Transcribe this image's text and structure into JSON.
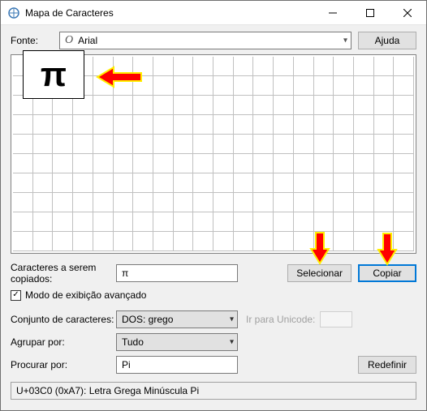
{
  "window": {
    "title": "Mapa de Caracteres"
  },
  "labels": {
    "fonte": "Fonte:",
    "ajuda": "Ajuda",
    "caracteres_copiar": "Caracteres a serem copiados:",
    "selecionar": "Selecionar",
    "copiar": "Copiar",
    "modo_avancado": "Modo de exibição avançado",
    "conjunto": "Conjunto de caracteres:",
    "agrupar": "Agrupar por:",
    "procurar": "Procurar por:",
    "redefinir": "Redefinir",
    "ir_unicode": "Ir para Unicode:"
  },
  "font": {
    "selected": "Arial",
    "italic_prefix": "O"
  },
  "enlarged_char": "π",
  "copy_field": "π",
  "charset": "DOS: grego",
  "group_by": "Tudo",
  "search": "Pi",
  "advanced_checked": "✓",
  "status": "U+03C0 (0xA7): Letra Grega Minúscula Pi"
}
